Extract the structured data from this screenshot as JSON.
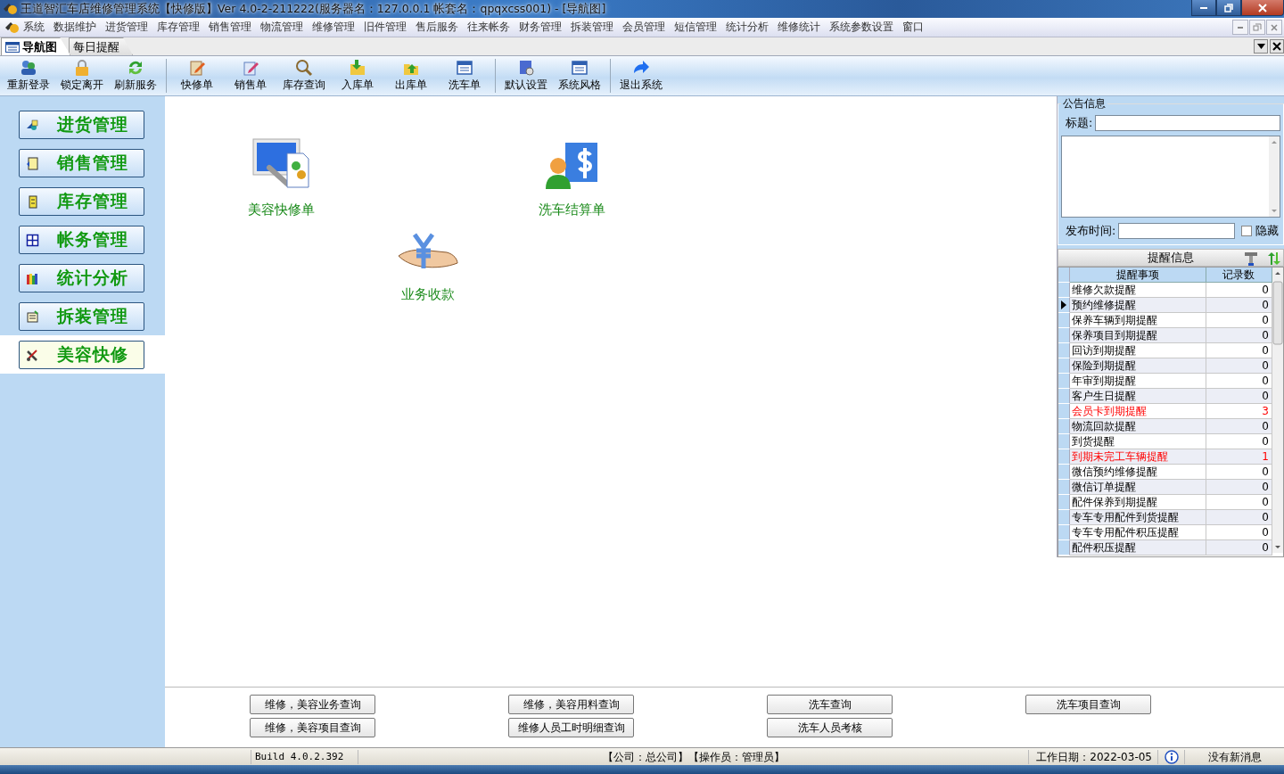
{
  "window": {
    "title": "王道智汇车店维修管理系统【快修版】Ver 4.0-2-211222(服务器名：127.0.0.1 帐套名：qpqxcss001) - [导航图]"
  },
  "menu": [
    "系统",
    "数据维护",
    "进货管理",
    "库存管理",
    "销售管理",
    "物流管理",
    "维修管理",
    "旧件管理",
    "售后服务",
    "往来帐务",
    "财务管理",
    "拆装管理",
    "会员管理",
    "短信管理",
    "统计分析",
    "维修统计",
    "系统参数设置",
    "窗口"
  ],
  "tabs": [
    {
      "label": "导航图",
      "selected": true
    },
    {
      "label": "每日提醒",
      "selected": false
    }
  ],
  "toolbar": [
    [
      {
        "label": "重新登录",
        "kind": "users"
      },
      {
        "label": "锁定离开",
        "kind": "lock"
      },
      {
        "label": "刷新服务",
        "kind": "refresh"
      }
    ],
    [
      {
        "label": "快修单",
        "kind": "clipboard"
      },
      {
        "label": "销售单",
        "kind": "pencil"
      },
      {
        "label": "库存查询",
        "kind": "search"
      },
      {
        "label": "入库单",
        "kind": "folder-in"
      },
      {
        "label": "出库单",
        "kind": "folder-out"
      },
      {
        "label": "洗车单",
        "kind": "window"
      }
    ],
    [
      {
        "label": "默认设置",
        "kind": "settings"
      },
      {
        "label": "系统风格",
        "kind": "window"
      }
    ],
    [
      {
        "label": "退出系统",
        "kind": "exit"
      }
    ]
  ],
  "sidebar": {
    "items": [
      {
        "label": "进货管理",
        "selected": false
      },
      {
        "label": "销售管理",
        "selected": false
      },
      {
        "label": "库存管理",
        "selected": false
      },
      {
        "label": "帐务管理",
        "selected": false
      },
      {
        "label": "统计分析",
        "selected": false
      },
      {
        "label": "拆装管理",
        "selected": false
      },
      {
        "label": "美容快修",
        "selected": true
      }
    ]
  },
  "shortcuts": [
    {
      "label": "美容快修单",
      "kind": "repair"
    },
    {
      "label": "洗车结算单",
      "kind": "billing"
    },
    {
      "label": "业务收款",
      "kind": "payment"
    }
  ],
  "query_buttons": [
    [
      "维修，美容业务查询",
      "维修，美容项目查询"
    ],
    [
      "维修，美容用料查询",
      "维修人员工时明细查询"
    ],
    [
      "洗车查询",
      "洗车人员考核"
    ],
    [
      "洗车项目查询"
    ]
  ],
  "notice": {
    "legend": "公告信息",
    "title_label": "标题:",
    "time_label": "发布时间:",
    "hide_label": "隐藏",
    "hide_checked": false
  },
  "reminders": {
    "title": "提醒信息",
    "columns": [
      "提醒事项",
      "记录数"
    ],
    "rows": [
      {
        "name": "维修欠款提醒",
        "count": "0",
        "alert": false,
        "current": false
      },
      {
        "name": "预约维修提醒",
        "count": "0",
        "alert": false,
        "current": true
      },
      {
        "name": "保养车辆到期提醒",
        "count": "0",
        "alert": false,
        "current": false
      },
      {
        "name": "保养项目到期提醒",
        "count": "0",
        "alert": false,
        "current": false
      },
      {
        "name": "回访到期提醒",
        "count": "0",
        "alert": false,
        "current": false
      },
      {
        "name": "保险到期提醒",
        "count": "0",
        "alert": false,
        "current": false
      },
      {
        "name": "年审到期提醒",
        "count": "0",
        "alert": false,
        "current": false
      },
      {
        "name": "客户生日提醒",
        "count": "0",
        "alert": false,
        "current": false
      },
      {
        "name": "会员卡到期提醒",
        "count": "3",
        "alert": true,
        "current": false
      },
      {
        "name": "物流回款提醒",
        "count": "0",
        "alert": false,
        "current": false
      },
      {
        "name": "到货提醒",
        "count": "0",
        "alert": false,
        "current": false
      },
      {
        "name": "到期未完工车辆提醒",
        "count": "1",
        "alert": true,
        "current": false
      },
      {
        "name": "微信预约维修提醒",
        "count": "0",
        "alert": false,
        "current": false
      },
      {
        "name": "微信订单提醒",
        "count": "0",
        "alert": false,
        "current": false
      },
      {
        "name": "配件保养到期提醒",
        "count": "0",
        "alert": false,
        "current": false
      },
      {
        "name": "专车专用配件到货提醒",
        "count": "0",
        "alert": false,
        "current": false
      },
      {
        "name": "专车专用配件积压提醒",
        "count": "0",
        "alert": false,
        "current": false
      },
      {
        "name": "配件积压提醒",
        "count": "0",
        "alert": false,
        "current": false
      }
    ]
  },
  "status_bar": {
    "build": "Build 4.0.2.392",
    "session": "【公司：总公司】【操作员：管理员】",
    "work_date": "工作日期：2022-03-05",
    "message": "没有新消息"
  }
}
